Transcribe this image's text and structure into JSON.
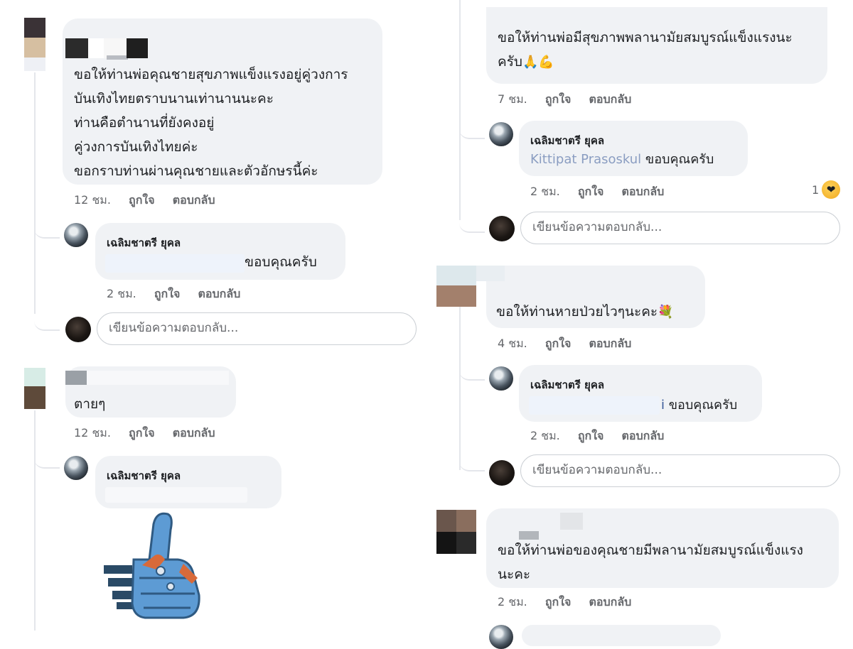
{
  "left_panel": {
    "comment1": {
      "lines": [
        "ขอให้ท่านพ่อคุณชายสุขภาพแข็งแรงอยู่คู่วงการ",
        "บันเทิงไทยตราบนานเท่านานนะคะ",
        "ท่านคือตำนานที่ยังคงอยู่",
        "คู่วงการบันเทิงไทยค่ะ",
        "ขอกราบท่านผ่านคุณชายและตัวอักษรนี้ค่ะ"
      ],
      "time": "12 ชม.",
      "like": "ถูกใจ",
      "reply": "ตอบกลับ"
    },
    "reply1": {
      "author": "เฉลิมชาตรี ยุคล",
      "mention_tail": "",
      "text": "ขอบคุณครับ",
      "time": "2 ชม.",
      "like": "ถูกใจ",
      "reply": "ตอบกลับ"
    },
    "reply_box1": {
      "placeholder": "เขียนข้อความตอบกลับ..."
    },
    "comment2": {
      "text": "ตายๆ",
      "time": "12 ชม.",
      "like": "ถูกใจ",
      "reply": "ตอบกลับ"
    },
    "reply2": {
      "author": "เฉลิมชาตรี ยุคล",
      "sticker": "thumbs-up-robot-sticker"
    }
  },
  "right_panel": {
    "comment1": {
      "line1": "ขอให้ท่านพ่อมีสุขภาพพลานามัยสมบูรณ์แข็งแรงนะ",
      "line2": "ครับ",
      "emojis": "🙏💪",
      "time": "7 ชม.",
      "like": "ถูกใจ",
      "reply": "ตอบกลับ"
    },
    "reply1": {
      "author": "เฉลิมชาตรี ยุคล",
      "mention": "Kittipat Prasoskul",
      "text": "ขอบคุณครับ",
      "time": "2 ชม.",
      "like": "ถูกใจ",
      "reply": "ตอบกลับ",
      "reaction_count": "1",
      "reaction_icon": "care-reaction-icon"
    },
    "reply_box1": {
      "placeholder": "เขียนข้อความตอบกลับ..."
    },
    "comment2": {
      "text": "ขอให้ท่านหายป่วยไวๆนะคะ",
      "emoji": "💐",
      "time": "4 ชม.",
      "like": "ถูกใจ",
      "reply": "ตอบกลับ"
    },
    "reply2": {
      "author": "เฉลิมชาตรี ยุคล",
      "mention_tail": "i",
      "text": "ขอบคุณครับ",
      "time": "2 ชม.",
      "like": "ถูกใจ",
      "reply": "ตอบกลับ"
    },
    "reply_box2": {
      "placeholder": "เขียนข้อความตอบกลับ..."
    },
    "comment3": {
      "line1": "ขอให้ท่านพ่อของคุณชายมีพลานามัยสมบูรณ์แข็งแรง",
      "line2": "นะคะ",
      "time": "2 ชม.",
      "like": "ถูกใจ",
      "reply": "ตอบกลับ"
    }
  }
}
